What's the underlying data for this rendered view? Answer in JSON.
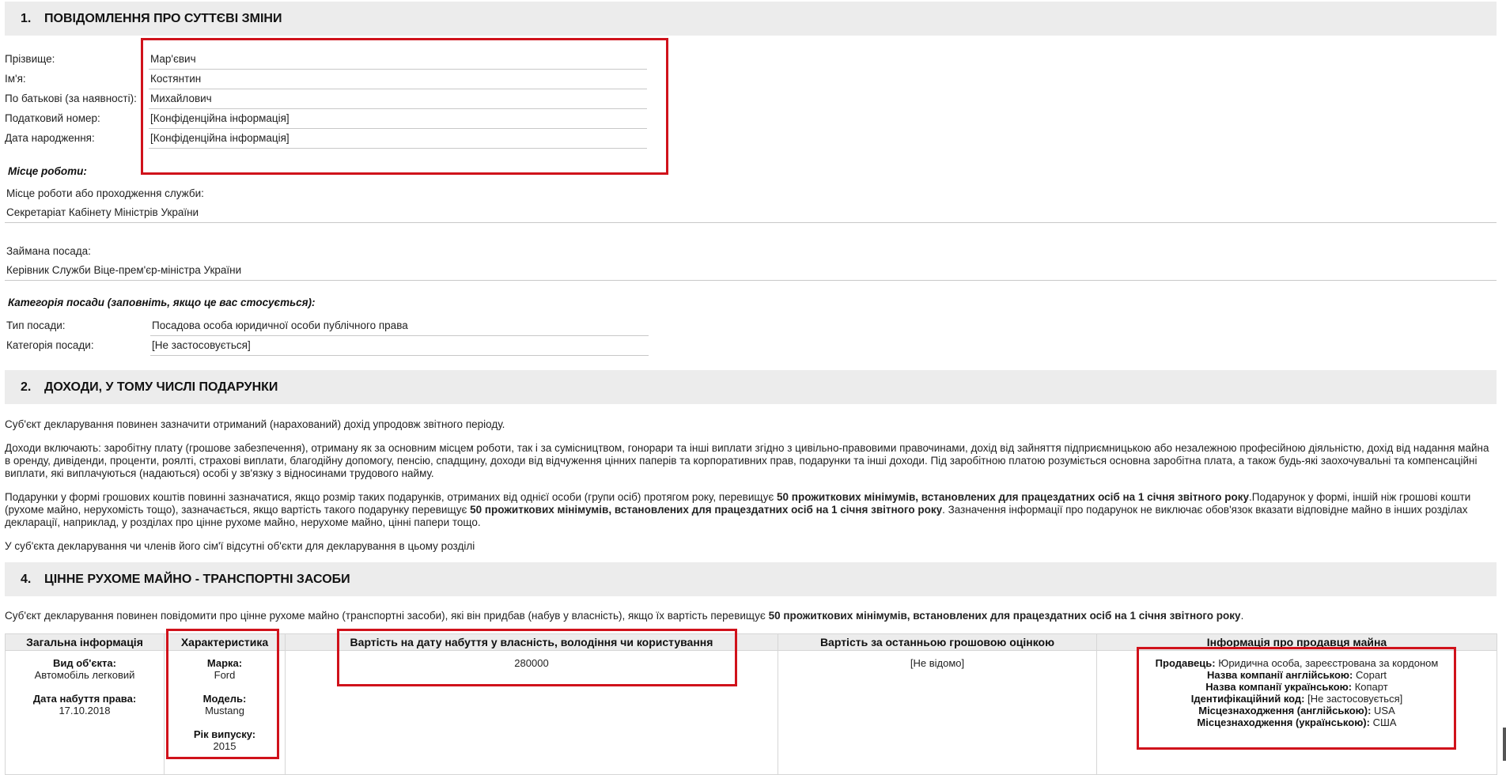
{
  "section1": {
    "number": "1.",
    "title": "ПОВІДОМЛЕННЯ ПРО СУТТЄВІ ЗМІНИ",
    "fields": [
      {
        "label": "Прізвище:",
        "value": "Мар'євич"
      },
      {
        "label": "Ім'я:",
        "value": "Костянтин"
      },
      {
        "label": "По батькові (за наявності):",
        "value": "Михайлович"
      },
      {
        "label": "Податковий номер:",
        "value": "[Конфіденційна інформація]"
      },
      {
        "label": "Дата народження:",
        "value": "[Конфіденційна інформація]"
      }
    ],
    "workplace_heading": "Місце роботи:",
    "workplace_label": "Місце роботи або проходження служби:",
    "workplace_value": "Секретаріат Кабінету Міністрів України",
    "position_label": "Займана посада:",
    "position_value": "Керівник Служби Віце-прем'єр-міністра України",
    "category_heading": "Категорія посади (заповніть, якщо це вас стосується):",
    "category_fields": [
      {
        "label": "Тип посади:",
        "value": "Посадова особа юридичної особи публічного права"
      },
      {
        "label": "Категорія посади:",
        "value": "[Не застосовується]"
      }
    ]
  },
  "section2": {
    "number": "2.",
    "title": "ДОХОДИ, У ТОМУ ЧИСЛІ ПОДАРУНКИ",
    "p1": "Суб'єкт декларування повинен зазначити отриманий (нарахований) дохід упродовж звітного періоду.",
    "p2": "Доходи включають: заробітну плату (грошове забезпечення), отриману як за основним місцем роботи, так і за сумісництвом, гонорари та інші виплати згідно з цивільно-правовими правочинами, дохід від зайняття підприємницькою або незалежною професійною діяльністю, дохід від надання майна в оренду, дивіденди, проценти, роялті, страхові виплати, благодійну допомогу, пенсію, спадщину, доходи від відчуження цінних паперів та корпоративних прав, подарунки та інші доходи. Під заробітною платою розуміється основна заробітна плата, а також будь-які заохочувальні та компенсаційні виплати, які виплачуються (надаються) особі у зв'язку з відносинами трудового найму.",
    "p3_a": "Подарунки у формі грошових коштів повинні зазначатися, якщо розмір таких подарунків, отриманих від однієї особи (групи осіб) протягом року, перевищує ",
    "p3_b": "50 прожиткових мінімумів, встановлених для працездатних осіб на 1 січня звітного року",
    "p3_c": ".Подарунок у формі, іншій ніж грошові кошти (рухоме майно, нерухомість тощо), зазначається, якщо вартість такого подарунку перевищує ",
    "p3_d": "50 прожиткових мінімумів, встановлених для працездатних осіб на 1 січня звітного року",
    "p3_e": ". Зазначення інформації про подарунок не виключає обов'язок вказати відповідне майно в інших розділах декларації, наприклад, у розділах про цінне рухоме майно, нерухоме майно, цінні папери тощо.",
    "p4": "У суб'єкта декларування чи членів його сім'ї відсутні об'єкти для декларування в цьому розділі"
  },
  "section4": {
    "number": "4.",
    "title": "ЦІННЕ РУХОМЕ МАЙНО - ТРАНСПОРТНІ ЗАСОБИ",
    "intro_a": "Суб'єкт декларування повинен повідомити про цінне рухоме майно (транспортні засоби), які він придбав (набув у власність), якщо їх вартість перевищує ",
    "intro_b": "50 прожиткових мінімумів, встановлених для працездатних осіб на 1 січня звітного року",
    "intro_c": ".",
    "headers": [
      "Загальна інформація",
      "Характеристика",
      "Вартість на дату набуття у власність, володіння чи користування",
      "Вартість за останньою грошовою оцінкою",
      "Інформація про продавця майна"
    ],
    "row": {
      "type_label": "Вид об'єкта:",
      "type_value": "Автомобіль легковий",
      "date_label": "Дата набуття права:",
      "date_value": "17.10.2018",
      "brand_label": "Марка:",
      "brand_value": "Ford",
      "model_label": "Модель:",
      "model_value": "Mustang",
      "year_label": "Рік випуску:",
      "year_value": "2015",
      "cost": "280000",
      "last_value": "[Не відомо]",
      "seller": [
        {
          "label": "Продавець:",
          "value": "Юридична особа, зареєстрована за кордоном"
        },
        {
          "label": "Назва компанії англійською:",
          "value": "Copart"
        },
        {
          "label": "Назва компанії українською:",
          "value": "Копарт"
        },
        {
          "label": "Ідентифікаційний код:",
          "value": "[Не застосовується]"
        },
        {
          "label": "Місцезнаходження (англійською):",
          "value": "USA"
        },
        {
          "label": "Місцезнаходження (українською):",
          "value": "США"
        }
      ]
    }
  },
  "colors": {
    "highlight": "#d0121b",
    "header_bg": "#ececec"
  }
}
